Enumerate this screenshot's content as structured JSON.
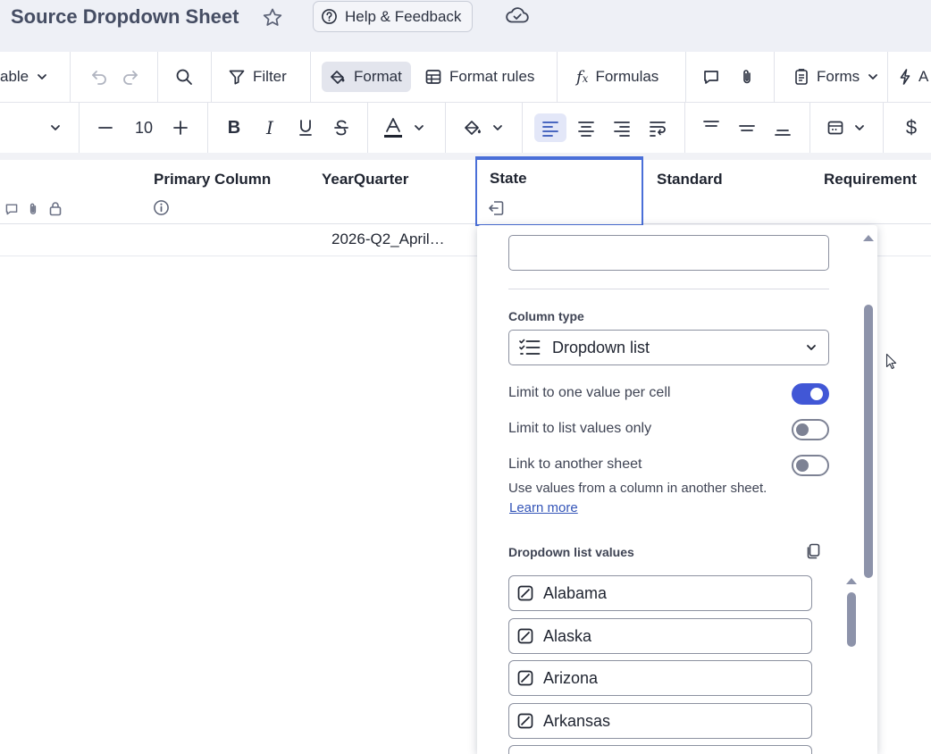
{
  "window": {
    "title": "Source Dropdown Sheet",
    "help_label": "Help & Feedback"
  },
  "toolbar": {
    "view_label": "able",
    "filter_label": "Filter",
    "format_label": "Format",
    "format_rules_label": "Format rules",
    "formulas_label": "Formulas",
    "forms_label": "Forms",
    "automation_label": "A"
  },
  "format_bar": {
    "font_size": "10",
    "currency_symbol": "$"
  },
  "grid": {
    "columns": [
      "Primary Column",
      "YearQuarter",
      "State",
      "Standard",
      "Requirement"
    ],
    "rows": [
      {
        "yearquarter": "2026-Q2_April…"
      }
    ]
  },
  "panel": {
    "description_value": "",
    "column_type_label": "Column type",
    "column_type_value": "Dropdown list",
    "options": {
      "one_value_label": "Limit to one value per cell",
      "one_value_on": true,
      "list_only_label": "Limit to list values only",
      "list_only_on": false,
      "link_sheet_label": "Link to another sheet",
      "link_sheet_on": false
    },
    "link_help": "Use values from a column in another sheet.",
    "learn_more": "Learn more",
    "values_label": "Dropdown list values",
    "values": [
      "Alabama",
      "Alaska",
      "Arizona",
      "Arkansas"
    ]
  },
  "colors": {
    "accent": "#4157d6",
    "selection_border": "#4a6fd8",
    "title_bar": "#eef0f6"
  },
  "icons": [
    "star-icon",
    "help-circle-icon",
    "cloud-sync-icon",
    "undo-icon",
    "redo-icon",
    "search-icon",
    "filter-icon",
    "paint-bucket-icon",
    "table-grid-icon",
    "fx-icon",
    "comment-icon",
    "paperclip-icon",
    "form-icon",
    "lightning-icon",
    "bold-icon",
    "italic-icon",
    "underline-icon",
    "strikethrough-icon",
    "text-color-icon",
    "fill-color-icon",
    "align-left-icon",
    "align-center-icon",
    "align-right-icon",
    "wrap-text-icon",
    "valign-top-icon",
    "valign-middle-icon",
    "valign-bottom-icon",
    "date-format-icon",
    "lock-icon",
    "info-icon",
    "column-move-icon",
    "dropdown-list-icon",
    "copy-icon",
    "no-color-icon",
    "chevron-down-icon",
    "mouse-pointer-icon"
  ]
}
